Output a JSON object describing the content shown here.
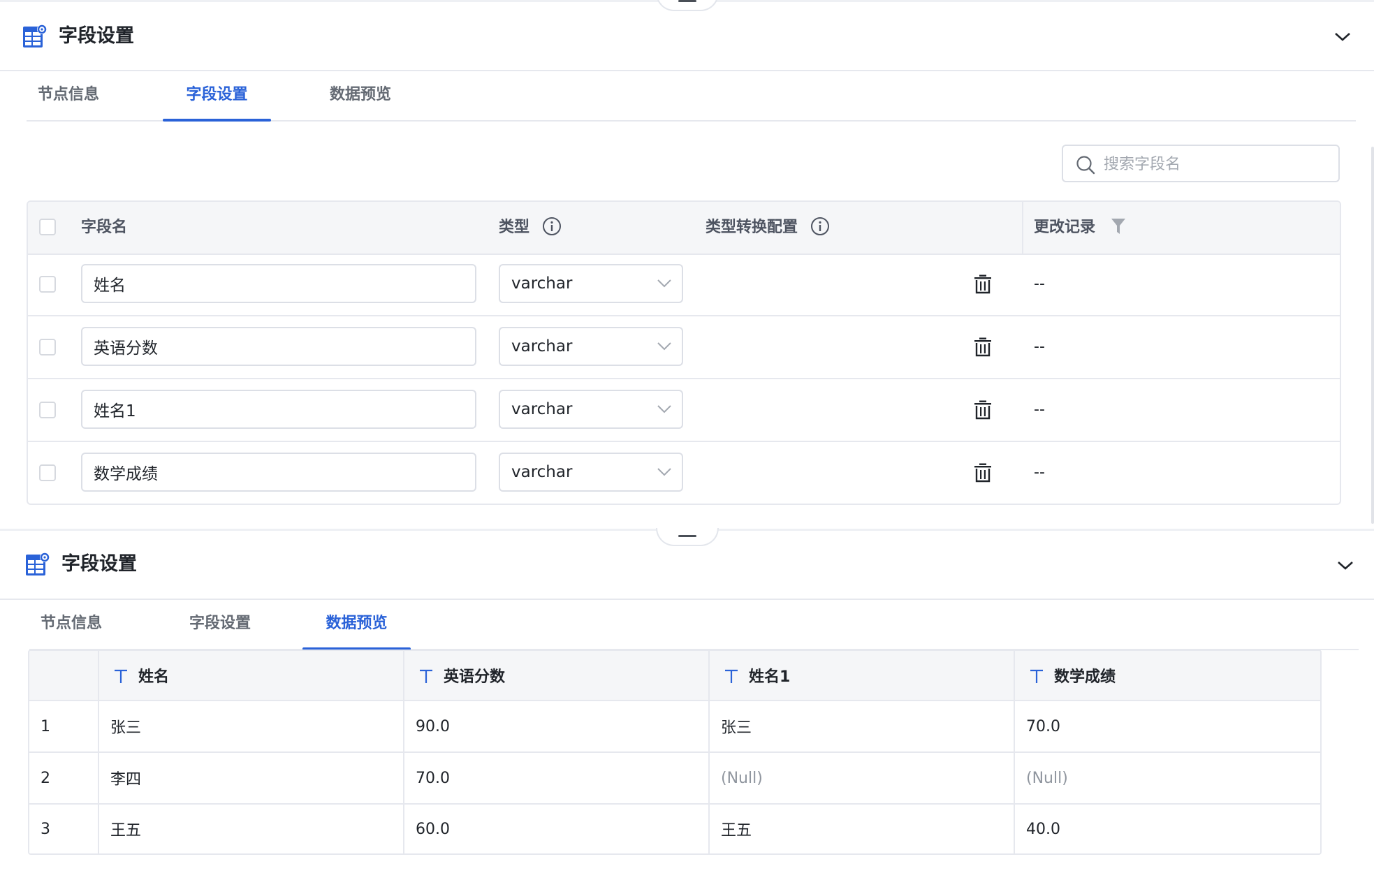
{
  "colors": {
    "accent": "#2a62d8",
    "text": "#1f2329",
    "muted": "#646a73",
    "border": "#e6e8ee",
    "header_bg": "#f5f6f8",
    "null_text": "#8f959e"
  },
  "top_panel": {
    "title": "字段设置",
    "header_icon": "table-settings-icon",
    "collapse_icon": "chevron-down-icon",
    "tabs": [
      {
        "label": "节点信息",
        "active": false
      },
      {
        "label": "字段设置",
        "active": true
      },
      {
        "label": "数据预览",
        "active": false
      }
    ],
    "search": {
      "placeholder": "搜索字段名",
      "value": ""
    },
    "field_table": {
      "columns": {
        "name": "字段名",
        "type": "类型",
        "type_conversion": "类型转换配置",
        "change_log": "更改记录"
      },
      "rows": [
        {
          "name": "姓名",
          "type": "varchar",
          "change_log": "--"
        },
        {
          "name": "英语分数",
          "type": "varchar",
          "change_log": "--"
        },
        {
          "name": "姓名1",
          "type": "varchar",
          "change_log": "--"
        },
        {
          "name": "数学成绩",
          "type": "varchar",
          "change_log": "--"
        }
      ]
    }
  },
  "bottom_panel": {
    "title": "字段设置",
    "header_icon": "table-settings-icon",
    "collapse_icon": "chevron-down-icon",
    "tabs": [
      {
        "label": "节点信息",
        "active": false
      },
      {
        "label": "字段设置",
        "active": false
      },
      {
        "label": "数据预览",
        "active": true
      }
    ],
    "preview_table": {
      "columns": [
        "姓名",
        "英语分数",
        "姓名1",
        "数学成绩"
      ],
      "rows": [
        {
          "index": "1",
          "cells": [
            "张三",
            "90.0",
            "张三",
            "70.0"
          ]
        },
        {
          "index": "2",
          "cells": [
            "李四",
            "70.0",
            "(Null)",
            "(Null)"
          ]
        },
        {
          "index": "3",
          "cells": [
            "王五",
            "60.0",
            "王五",
            "40.0"
          ]
        }
      ]
    }
  }
}
